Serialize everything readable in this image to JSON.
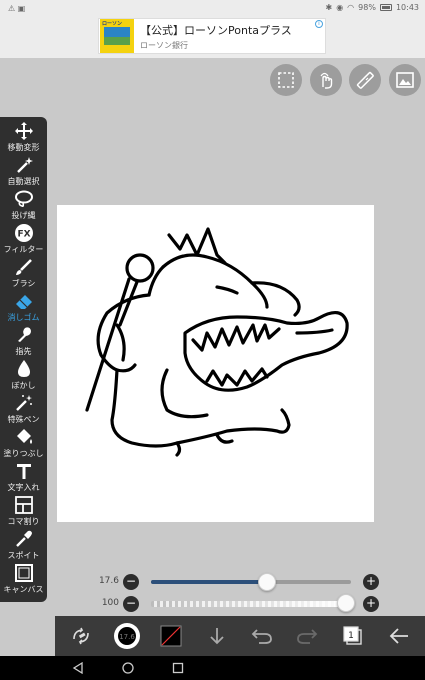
{
  "status_bar": {
    "left_icons": "⚠ ▣",
    "battery": "98%",
    "time": "10:43"
  },
  "ad": {
    "title": "【公式】ローソンPontaプラス",
    "subtitle": "ローソン銀行",
    "thumb_text": "ローソン"
  },
  "top_buttons": [
    {
      "name": "selection-icon"
    },
    {
      "name": "gesture-icon"
    },
    {
      "name": "ruler-icon"
    },
    {
      "name": "image-icon"
    }
  ],
  "toolbar": {
    "active_color": "#3aa6e8",
    "items": [
      {
        "label": "移動変形",
        "icon": "move-icon"
      },
      {
        "label": "自動選択",
        "icon": "magic-wand-icon"
      },
      {
        "label": "投げ縄",
        "icon": "lasso-icon"
      },
      {
        "label": "フィルター",
        "icon": "filter-fx-icon"
      },
      {
        "label": "ブラシ",
        "icon": "brush-icon"
      },
      {
        "label": "消しゴム",
        "icon": "eraser-icon",
        "active": true
      },
      {
        "label": "指先",
        "icon": "finger-icon"
      },
      {
        "label": "ぼかし",
        "icon": "blur-drop-icon"
      },
      {
        "label": "特殊ペン",
        "icon": "special-pen-icon"
      },
      {
        "label": "塗りつぶし",
        "icon": "fill-bucket-icon"
      },
      {
        "label": "文字入れ",
        "icon": "text-icon"
      },
      {
        "label": "コマ割り",
        "icon": "frame-divide-icon"
      },
      {
        "label": "スポイト",
        "icon": "eyedropper-icon"
      },
      {
        "label": "キャンバス",
        "icon": "canvas-icon"
      }
    ]
  },
  "sliders": {
    "size": {
      "value": "17.6",
      "fraction": 0.58
    },
    "opacity": {
      "value": "100",
      "fraction": 1.0
    },
    "minus": "−",
    "plus": "+"
  },
  "bottom_bar": {
    "brush_size_label": "17.6",
    "layer_count": "1",
    "icons": [
      "transform-flip-icon",
      "brush-preview-icon",
      "color-swatch-icon",
      "download-arrow-icon",
      "undo-icon",
      "redo-icon",
      "layers-icon",
      "back-arrow-icon"
    ]
  },
  "nav_bar": {
    "icons": [
      "nav-back-icon",
      "nav-home-icon",
      "nav-recents-icon"
    ]
  },
  "colors": {
    "toolbar_bg": "#2f2f2f",
    "size_fill": "#2c4f7a",
    "app_bg": "#c9c9c9"
  }
}
